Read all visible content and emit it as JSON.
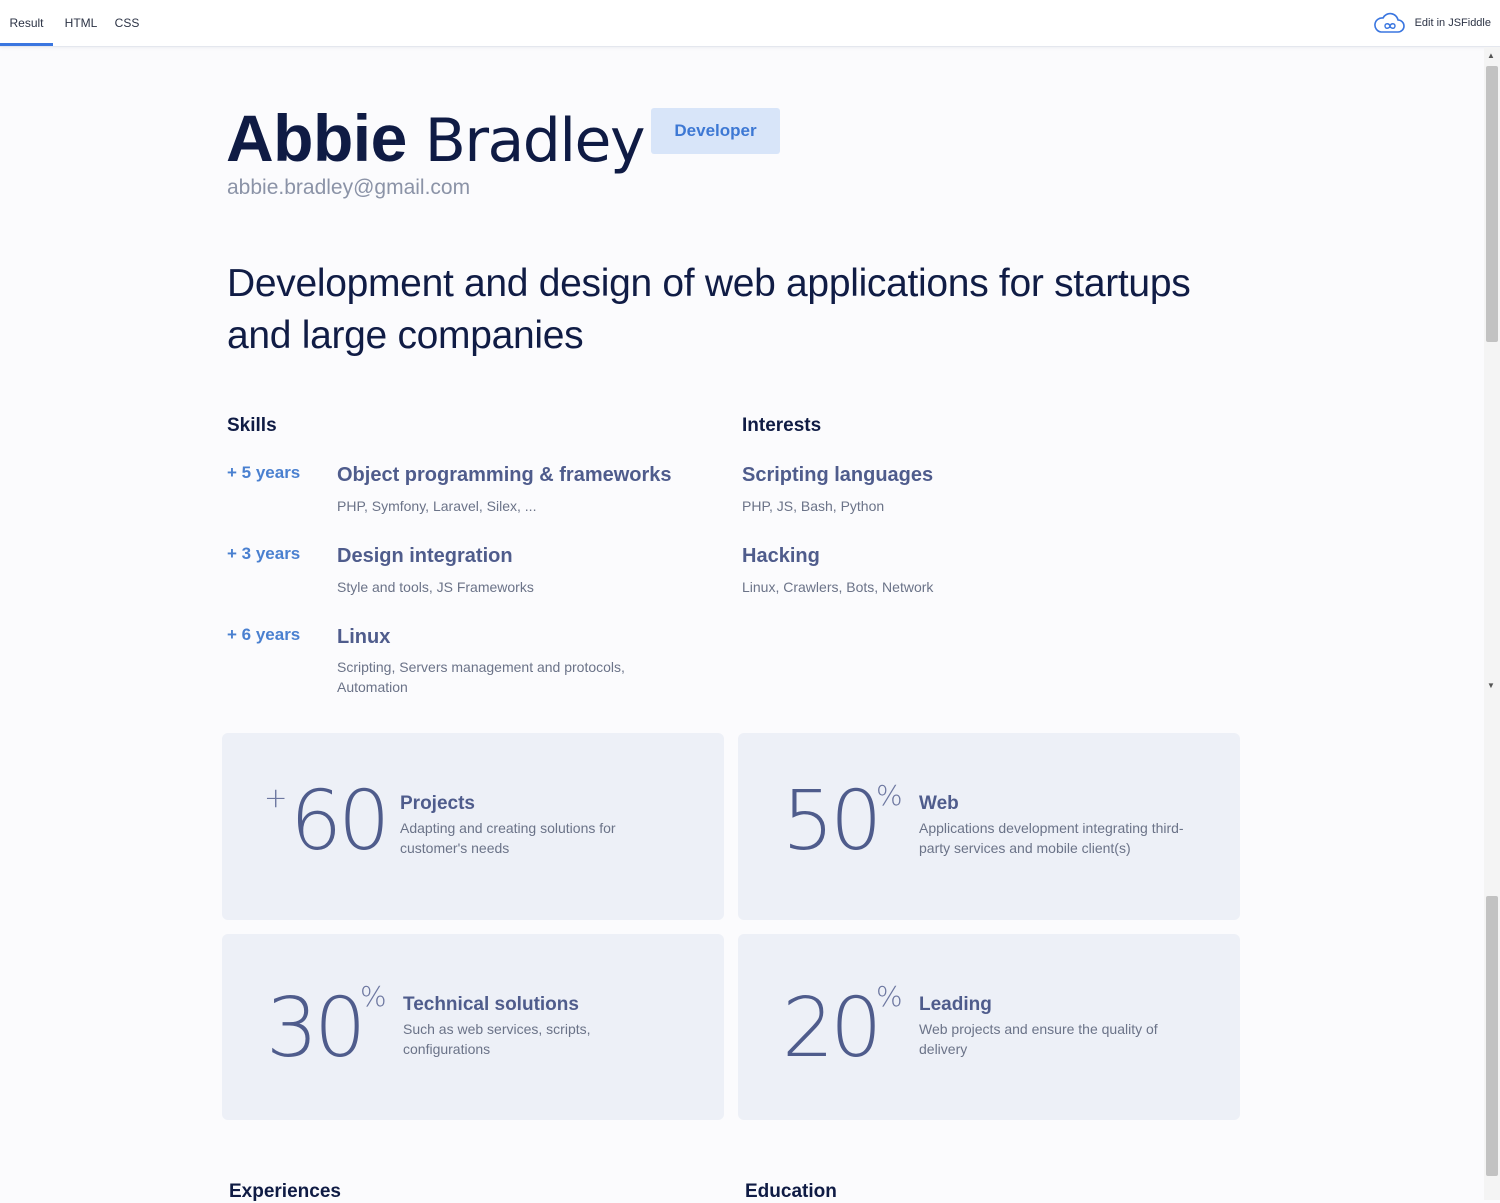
{
  "tabs": [
    {
      "label": "Result",
      "active": true
    },
    {
      "label": "HTML",
      "active": false
    },
    {
      "label": "CSS",
      "active": false
    }
  ],
  "edit_link": {
    "label": "Edit in JSFiddle",
    "icon": "cloud-infinity-icon"
  },
  "profile": {
    "first_name": "Abbie",
    "last_name": "Bradley",
    "role": "Developer",
    "email": "abbie.bradley@gmail.com",
    "tagline": "Development and design of web applications for startups and large companies"
  },
  "skills": {
    "title": "Skills",
    "items": [
      {
        "years": "+ 5 years",
        "title": "Object programming & frameworks",
        "desc": "PHP, Symfony, Laravel, Silex, ..."
      },
      {
        "years": "+ 3 years",
        "title": "Design integration",
        "desc": "Style and tools, JS Frameworks"
      },
      {
        "years": "+ 6 years",
        "title": "Linux",
        "desc": "Scripting, Servers management and protocols, Automation"
      }
    ]
  },
  "interests": {
    "title": "Interests",
    "items": [
      {
        "title": "Scripting languages",
        "desc": "PHP, JS, Bash, Python"
      },
      {
        "title": "Hacking",
        "desc": "Linux, Crawlers, Bots, Network"
      }
    ]
  },
  "stats": [
    {
      "prefix": "+",
      "number": "60",
      "suffix": "",
      "title": "Projects",
      "desc": "Adapting and creating solutions for customer's needs"
    },
    {
      "prefix": "",
      "number": "50",
      "suffix": "%",
      "title": "Web",
      "desc": "Applications development integrating third-party services and mobile client(s)"
    },
    {
      "prefix": "",
      "number": "30",
      "suffix": "%",
      "title": "Technical solutions",
      "desc": "Such as web services, scripts, configurations"
    },
    {
      "prefix": "",
      "number": "20",
      "suffix": "%",
      "title": "Leading",
      "desc": "Web projects and ensure the quality of delivery"
    }
  ],
  "bottom_sections": {
    "experiences": "Experiences",
    "education": "Education"
  },
  "colors": {
    "accent": "#3a76e0",
    "badge_bg": "#d8e5f9",
    "card_bg": "#edf0f7",
    "heading": "#0f1b44",
    "muted": "#4f5c8c"
  }
}
